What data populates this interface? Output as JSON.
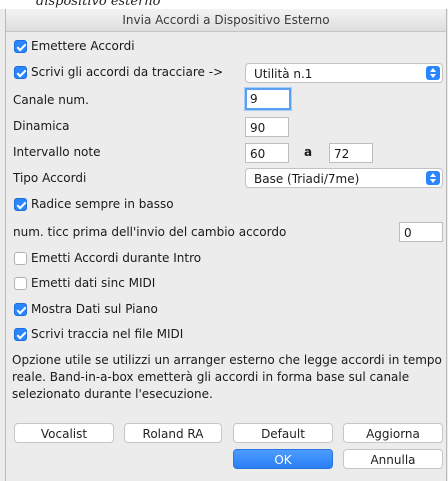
{
  "caption": "dispositivo esterno",
  "window": {
    "title": "Invia Accordi a Dispositivo Esterno"
  },
  "emit_chords": {
    "label": "Emettere Accordi",
    "checked": true
  },
  "write_chords": {
    "label": "Scrivi gli accordi da tracciare ->",
    "checked": true,
    "track_value": "Utilità n.1"
  },
  "channel": {
    "label": "Canale num.",
    "value": "9"
  },
  "dynamics": {
    "label": "Dinamica",
    "value": "90"
  },
  "note_range": {
    "label": "Intervallo note",
    "from": "60",
    "to_label": "a",
    "to": "72"
  },
  "chord_type": {
    "label": "Tipo Accordi",
    "value": "Base (Triadi/7me)"
  },
  "root_in_bass": {
    "label": "Radice sempre in basso",
    "checked": true
  },
  "ticks_before": {
    "label": "num. ticc prima dell'invio del cambio accordo",
    "value": "0"
  },
  "emit_intro": {
    "label": "Emetti Accordi durante Intro",
    "checked": false
  },
  "emit_sync": {
    "label": "Emetti dati sinc MIDI",
    "checked": false
  },
  "show_piano": {
    "label": "Mostra Dati sul Piano",
    "checked": true
  },
  "write_midi": {
    "label": "Scrivi traccia nel file MIDI",
    "checked": true
  },
  "info_text": "Opzione utile se utilizzi un arranger esterno che legge accordi in tempo reale.  Band-in-a-box emetterà gli accordi in forma base sul canale selezionato durante l'esecuzione.",
  "buttons": {
    "vocalist": "Vocalist",
    "roland": "Roland RA",
    "default": "Default",
    "update": "Aggiorna",
    "ok": "OK",
    "cancel": "Annulla"
  },
  "accent_color": "#2a86ff"
}
